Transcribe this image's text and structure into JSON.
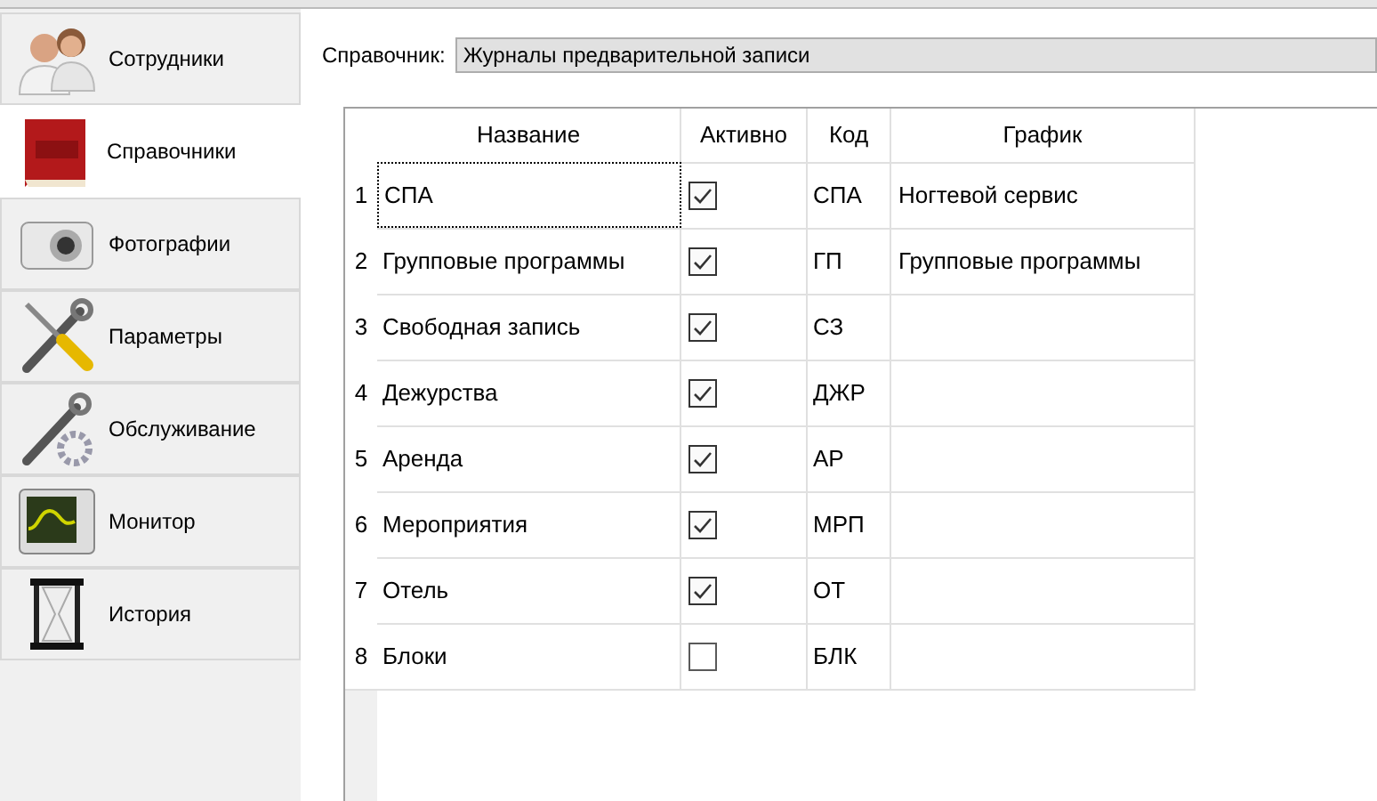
{
  "sidebar": {
    "items": [
      {
        "label": "Сотрудники",
        "kind": "people",
        "selected": false
      },
      {
        "label": "Справочники",
        "kind": "book",
        "selected": true
      },
      {
        "label": "Фотографии",
        "kind": "camera",
        "selected": false
      },
      {
        "label": "Параметры",
        "kind": "tools",
        "selected": false
      },
      {
        "label": "Обслуживание",
        "kind": "service",
        "selected": false
      },
      {
        "label": "Монитор",
        "kind": "monitor",
        "selected": false
      },
      {
        "label": "История",
        "kind": "hourglass",
        "selected": false
      }
    ]
  },
  "reference": {
    "label": "Справочник:",
    "value": "Журналы предварительной записи"
  },
  "table": {
    "columns": [
      "Название",
      "Активно",
      "Код",
      "График"
    ],
    "rows": [
      {
        "number": "1",
        "name": "СПА",
        "active": true,
        "code": "СПА",
        "schedule": "Ногтевой сервис",
        "focused": true
      },
      {
        "number": "2",
        "name": "Групповые программы",
        "active": true,
        "code": "ГП",
        "schedule": "Групповые программы",
        "focused": false
      },
      {
        "number": "3",
        "name": "Свободная запись",
        "active": true,
        "code": "СЗ",
        "focused": false
      },
      {
        "number": "4",
        "name": "Дежурства",
        "active": true,
        "code": "ДЖР",
        "focused": false
      },
      {
        "number": "5",
        "name": "Аренда",
        "active": true,
        "code": "АР",
        "focused": false
      },
      {
        "number": "6",
        "name": "Мероприятия",
        "active": true,
        "code": "МРП",
        "focused": false
      },
      {
        "number": "7",
        "name": "Отель",
        "active": true,
        "code": "ОТ",
        "focused": false
      },
      {
        "number": "8",
        "name": "Блоки",
        "active": false,
        "code": "БЛК",
        "focused": false
      }
    ]
  }
}
